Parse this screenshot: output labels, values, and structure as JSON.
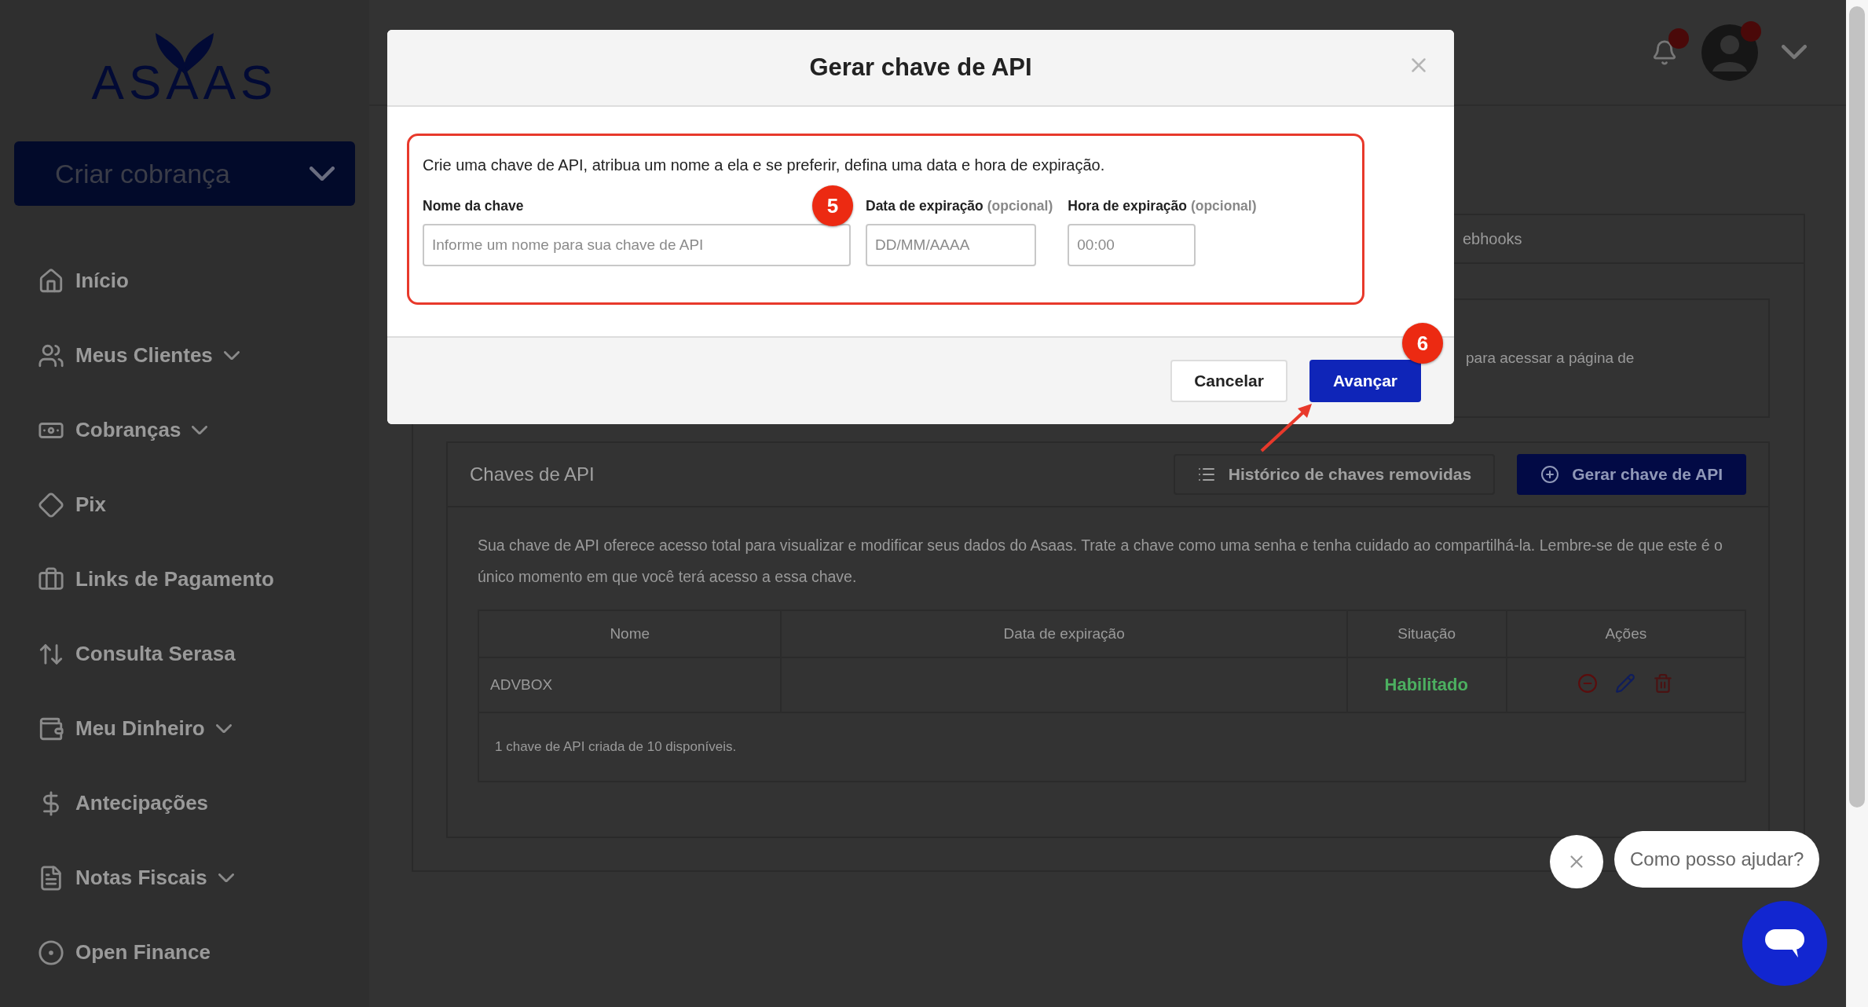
{
  "sidebar": {
    "logo": "ASAAS",
    "create_button": "Criar cobrança",
    "items": [
      {
        "label": "Início",
        "expandable": false
      },
      {
        "label": "Meus Clientes",
        "expandable": true
      },
      {
        "label": "Cobranças",
        "expandable": true
      },
      {
        "label": "Pix",
        "expandable": false
      },
      {
        "label": "Links de Pagamento",
        "expandable": false
      },
      {
        "label": "Consulta Serasa",
        "expandable": false
      },
      {
        "label": "Meu Dinheiro",
        "expandable": true
      },
      {
        "label": "Antecipações",
        "expandable": false
      },
      {
        "label": "Notas Fiscais",
        "expandable": true
      },
      {
        "label": "Open Finance",
        "expandable": false
      }
    ]
  },
  "tab_fragment": "ebhooks",
  "notice_fragment": "para acessar a página de",
  "api_keys": {
    "title": "Chaves de API",
    "history_button": "Histórico de chaves removidas",
    "generate_button": "Gerar chave de API",
    "description": "Sua chave de API oferece acesso total para visualizar e modificar seus dados do Asaas. Trate a chave como uma senha e tenha cuidado ao compartilhá-la. Lembre-se de que este é o único momento em que você terá acesso a essa chave.",
    "table": {
      "columns": [
        "Nome",
        "Data de expiração",
        "Situação",
        "Ações"
      ],
      "rows": [
        {
          "name": "ADVBOX",
          "status": "Habilitado"
        }
      ],
      "footer": "1 chave de API criada de 10 disponíveis."
    }
  },
  "modal": {
    "title": "Gerar chave de API",
    "intro": "Crie uma chave de API, atribua um nome a ela e se preferir, defina uma data e hora de expiração.",
    "fields": [
      {
        "label": "Nome da chave",
        "placeholder": "Informe um nome para sua chave de API"
      },
      {
        "label": "Data de expiração",
        "hint": "(opcional)",
        "placeholder": "DD/MM/AAAA"
      },
      {
        "label": "Hora de expiração",
        "hint": "(opcional)",
        "placeholder": "00:00"
      }
    ],
    "buttons": [
      {
        "label": "Cancelar",
        "kind": "secondary"
      },
      {
        "label": "Avançar",
        "kind": "primary"
      }
    ]
  },
  "annotations": [
    {
      "label": "5"
    },
    {
      "label": "6"
    }
  ],
  "chat": {
    "prompt": "Como posso ajudar?"
  }
}
